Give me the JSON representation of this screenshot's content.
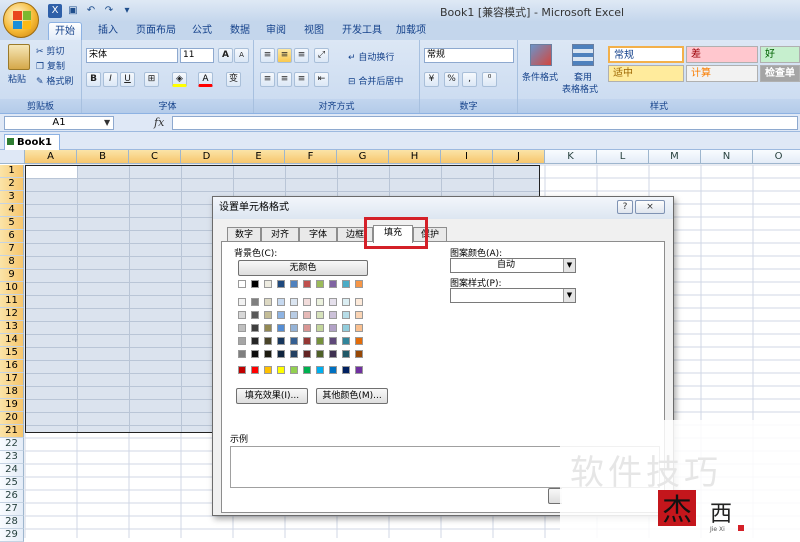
{
  "window": {
    "title": "Book1  [兼容模式] - Microsoft Excel"
  },
  "tabs": [
    "开始",
    "插入",
    "页面布局",
    "公式",
    "数据",
    "审阅",
    "视图",
    "开发工具",
    "加载项"
  ],
  "ribbon": {
    "clipboard": {
      "paste": "粘贴",
      "cut": "剪切",
      "copy": "复制",
      "painter": "格式刷",
      "label": "剪贴板"
    },
    "font": {
      "name": "宋体",
      "size": "11",
      "label": "字体",
      "bold": "B",
      "italic": "I",
      "underline": "U",
      "grow": "A",
      "shrink": "A",
      "fontcolor": "A",
      "phonetic": "变"
    },
    "align": {
      "wrap": "自动换行",
      "merge": "合并后居中",
      "label": "对齐方式"
    },
    "number": {
      "format": "常规",
      "label": "数字",
      "percent": "%",
      "comma": ","
    },
    "styles": {
      "cond": "条件格式",
      "table": "套用",
      "table2": "表格格式",
      "label": "样式",
      "cells": [
        {
          "text": "常规",
          "bg": "#ffffff",
          "fg": "#000000"
        },
        {
          "text": "差",
          "bg": "#ffc7ce",
          "fg": "#9c0006"
        },
        {
          "text": "好",
          "bg": "#c6efce",
          "fg": "#006100"
        },
        {
          "text": "适中",
          "bg": "#ffeb9c",
          "fg": "#9c6500"
        },
        {
          "text": "计算",
          "bg": "#f2f2f2",
          "fg": "#fa7d00"
        },
        {
          "text": "检查单",
          "bg": "#a5a5a5",
          "fg": "#ffffff"
        }
      ]
    }
  },
  "formula": {
    "namebox": "A1",
    "fx": "fx"
  },
  "workbook_tab": "Book1 *",
  "columns": [
    "A",
    "B",
    "C",
    "D",
    "E",
    "F",
    "G",
    "H",
    "I",
    "J",
    "K",
    "L",
    "M",
    "N",
    "O"
  ],
  "rows": [
    "1",
    "2",
    "3",
    "4",
    "5",
    "6",
    "7",
    "8",
    "9",
    "10",
    "11",
    "12",
    "13",
    "14",
    "15",
    "16",
    "17",
    "18",
    "19",
    "20",
    "21",
    "22",
    "23",
    "24",
    "25",
    "26",
    "27",
    "28",
    "29"
  ],
  "dialog": {
    "title": "设置单元格格式",
    "help": "?",
    "close": "×",
    "tabs": [
      "数字",
      "对齐",
      "字体",
      "边框",
      "填充",
      "保护"
    ],
    "bg_label": "背景色(C):",
    "no_color": "无颜色",
    "fill_effects": "填充效果(I)...",
    "more_colors": "其他颜色(M)...",
    "pattern_color_label": "图案颜色(A):",
    "pattern_color_value": "自动",
    "pattern_style_label": "图案样式(P):",
    "sample_label": "示例",
    "palette": {
      "row1": [
        "#ffffff",
        "#000000",
        "#eeece1",
        "#1f497d",
        "#4f81bd",
        "#c0504d",
        "#9bbb59",
        "#8064a2",
        "#4bacc6",
        "#f79646"
      ],
      "rows": [
        [
          "#f2f2f2",
          "#7f7f7f",
          "#ddd9c3",
          "#c6d9f0",
          "#dbe5f1",
          "#f2dcdb",
          "#ebf1dd",
          "#e5e0ec",
          "#dbeef3",
          "#fdeada"
        ],
        [
          "#d8d8d8",
          "#595959",
          "#c4bd97",
          "#8db3e2",
          "#b8cce4",
          "#e5b9b7",
          "#d7e3bc",
          "#ccc1d9",
          "#b7dde8",
          "#fbd5b5"
        ],
        [
          "#bfbfbf",
          "#3f3f3f",
          "#938953",
          "#548dd4",
          "#95b3d7",
          "#d99694",
          "#c3d69b",
          "#b2a2c7",
          "#92cddc",
          "#fac08f"
        ],
        [
          "#a5a5a5",
          "#262626",
          "#494429",
          "#17365d",
          "#366092",
          "#953734",
          "#76923c",
          "#5f497a",
          "#31859b",
          "#e36c09"
        ],
        [
          "#7f7f7f",
          "#0c0c0c",
          "#1d1b10",
          "#0f243e",
          "#244061",
          "#632423",
          "#4f6128",
          "#3f3151",
          "#205867",
          "#974806"
        ]
      ],
      "standard": [
        "#c00000",
        "#ff0000",
        "#ffc000",
        "#ffff00",
        "#92d050",
        "#00b050",
        "#00b0f0",
        "#0070c0",
        "#002060",
        "#7030a0"
      ]
    }
  },
  "watermark": {
    "text": "软件技巧",
    "logo_char1": "杰",
    "logo_char2": "西",
    "logo_sub": "Jie Xi"
  },
  "colors": {
    "accent": "#d42028",
    "ribbon": "#c9daf0",
    "selection": "#dbe3ee"
  }
}
